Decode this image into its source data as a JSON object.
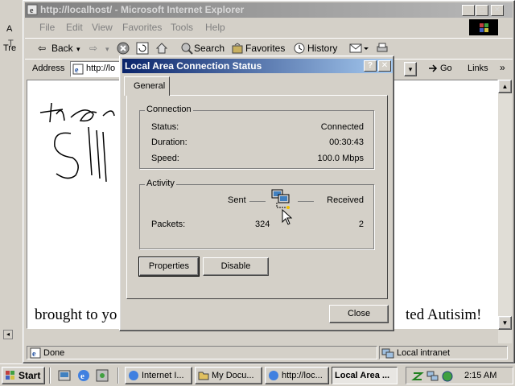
{
  "ie": {
    "title": "http://localhost/ - Microsoft Internet Explorer",
    "menu": [
      "File",
      "Edit",
      "View",
      "Favorites",
      "Tools",
      "Help"
    ],
    "toolbar": {
      "back": "Back",
      "search": "Search",
      "favorites": "Favorites",
      "history": "History"
    },
    "address_label": "Address",
    "address_value": "http://lo",
    "go": "Go",
    "links": "Links",
    "page_text": "brought to yo",
    "page_text_right": "ted Autisim!",
    "status": "Done",
    "zone": "Local intranet"
  },
  "background_left": {
    "labels": [
      "A",
      "T",
      "Tre"
    ]
  },
  "dialog": {
    "title": "Local Area Connection Status",
    "tab": "General",
    "connection": {
      "label": "Connection",
      "rows": [
        {
          "label": "Status:",
          "value": "Connected"
        },
        {
          "label": "Duration:",
          "value": "00:30:43"
        },
        {
          "label": "Speed:",
          "value": "100.0 Mbps"
        }
      ]
    },
    "activity": {
      "label": "Activity",
      "sent": "Sent",
      "received": "Received",
      "packets_label": "Packets:",
      "packets_sent": "324",
      "packets_received": "2"
    },
    "properties": "Properties",
    "disable": "Disable",
    "close": "Close"
  },
  "taskbar": {
    "start": "Start",
    "tasks": [
      "Internet I...",
      "My Docu...",
      "http://loc...",
      "Local Area ..."
    ],
    "clock": "2:15 AM"
  },
  "colors": {
    "title_active": "#0a246a",
    "desktop": "#3a6ea5",
    "face": "#d4d0c8"
  }
}
